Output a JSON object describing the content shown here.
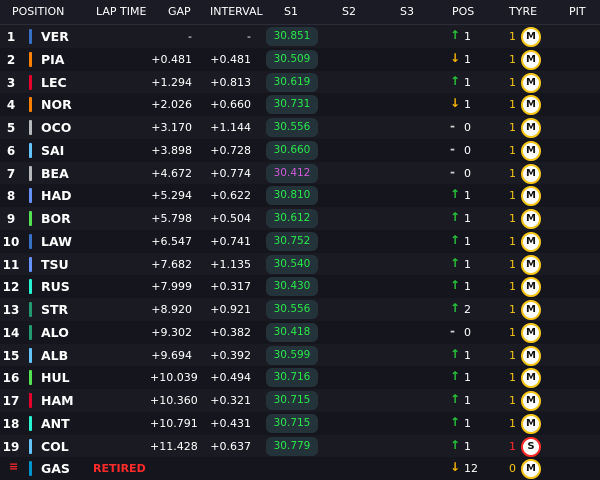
{
  "colors": {
    "up": "#29c33b",
    "down": "#f4b400",
    "best": "#29e84a",
    "purple": "#d15ad9",
    "medium": "#f5c518",
    "soft": "#ff2b2b"
  },
  "headers": {
    "position": "POSITION",
    "lap_time": "LAP TIME",
    "gap": "GAP",
    "interval": "INTERVAL",
    "s1": "S1",
    "s2": "S2",
    "s3": "S3",
    "pos": "POS",
    "tyre": "TYRE",
    "pit": "PIT"
  },
  "rows": [
    {
      "pos": "1",
      "code": "VER",
      "team": "#3671c6",
      "gap": "-",
      "interval": "-",
      "s1": "30.851",
      "s1_color": "best",
      "dir": "up",
      "delta": "1",
      "tyre_laps": "1",
      "tyre": "M"
    },
    {
      "pos": "2",
      "code": "PIA",
      "team": "#ff8000",
      "gap": "+0.481",
      "interval": "+0.481",
      "s1": "30.509",
      "s1_color": "best",
      "dir": "down",
      "delta": "1",
      "tyre_laps": "1",
      "tyre": "M"
    },
    {
      "pos": "3",
      "code": "LEC",
      "team": "#e8002d",
      "gap": "+1.294",
      "interval": "+0.813",
      "s1": "30.619",
      "s1_color": "best",
      "dir": "up",
      "delta": "1",
      "tyre_laps": "1",
      "tyre": "M"
    },
    {
      "pos": "4",
      "code": "NOR",
      "team": "#ff8000",
      "gap": "+2.026",
      "interval": "+0.660",
      "s1": "30.731",
      "s1_color": "best",
      "dir": "down",
      "delta": "1",
      "tyre_laps": "1",
      "tyre": "M"
    },
    {
      "pos": "5",
      "code": "OCO",
      "team": "#b6babd",
      "gap": "+3.170",
      "interval": "+1.144",
      "s1": "30.556",
      "s1_color": "best",
      "dir": "none",
      "delta": "0",
      "tyre_laps": "1",
      "tyre": "M"
    },
    {
      "pos": "6",
      "code": "SAI",
      "team": "#64c4ff",
      "gap": "+3.898",
      "interval": "+0.728",
      "s1": "30.660",
      "s1_color": "best",
      "dir": "none",
      "delta": "0",
      "tyre_laps": "1",
      "tyre": "M"
    },
    {
      "pos": "7",
      "code": "BEA",
      "team": "#b6babd",
      "gap": "+4.672",
      "interval": "+0.774",
      "s1": "30.412",
      "s1_color": "purple",
      "dir": "none",
      "delta": "0",
      "tyre_laps": "1",
      "tyre": "M"
    },
    {
      "pos": "8",
      "code": "HAD",
      "team": "#6692ff",
      "gap": "+5.294",
      "interval": "+0.622",
      "s1": "30.810",
      "s1_color": "best",
      "dir": "up",
      "delta": "1",
      "tyre_laps": "1",
      "tyre": "M"
    },
    {
      "pos": "9",
      "code": "BOR",
      "team": "#52e252",
      "gap": "+5.798",
      "interval": "+0.504",
      "s1": "30.612",
      "s1_color": "best",
      "dir": "up",
      "delta": "1",
      "tyre_laps": "1",
      "tyre": "M"
    },
    {
      "pos": "10",
      "code": "LAW",
      "team": "#3671c6",
      "gap": "+6.547",
      "interval": "+0.741",
      "s1": "30.752",
      "s1_color": "best",
      "dir": "up",
      "delta": "1",
      "tyre_laps": "1",
      "tyre": "M"
    },
    {
      "pos": "11",
      "code": "TSU",
      "team": "#6692ff",
      "gap": "+7.682",
      "interval": "+1.135",
      "s1": "30.540",
      "s1_color": "best",
      "dir": "up",
      "delta": "1",
      "tyre_laps": "1",
      "tyre": "M"
    },
    {
      "pos": "12",
      "code": "RUS",
      "team": "#27f4d2",
      "gap": "+7.999",
      "interval": "+0.317",
      "s1": "30.430",
      "s1_color": "best",
      "dir": "up",
      "delta": "1",
      "tyre_laps": "1",
      "tyre": "M"
    },
    {
      "pos": "13",
      "code": "STR",
      "team": "#229971",
      "gap": "+8.920",
      "interval": "+0.921",
      "s1": "30.556",
      "s1_color": "best",
      "dir": "up",
      "delta": "2",
      "tyre_laps": "1",
      "tyre": "M"
    },
    {
      "pos": "14",
      "code": "ALO",
      "team": "#229971",
      "gap": "+9.302",
      "interval": "+0.382",
      "s1": "30.418",
      "s1_color": "best",
      "dir": "none",
      "delta": "0",
      "tyre_laps": "1",
      "tyre": "M"
    },
    {
      "pos": "15",
      "code": "ALB",
      "team": "#64c4ff",
      "gap": "+9.694",
      "interval": "+0.392",
      "s1": "30.599",
      "s1_color": "best",
      "dir": "up",
      "delta": "1",
      "tyre_laps": "1",
      "tyre": "M"
    },
    {
      "pos": "16",
      "code": "HUL",
      "team": "#52e252",
      "gap": "+10.039",
      "interval": "+0.494",
      "s1": "30.716",
      "s1_color": "best",
      "dir": "up",
      "delta": "1",
      "tyre_laps": "1",
      "tyre": "M"
    },
    {
      "pos": "17",
      "code": "HAM",
      "team": "#e8002d",
      "gap": "+10.360",
      "interval": "+0.321",
      "s1": "30.715",
      "s1_color": "best",
      "dir": "up",
      "delta": "1",
      "tyre_laps": "1",
      "tyre": "M"
    },
    {
      "pos": "18",
      "code": "ANT",
      "team": "#27f4d2",
      "gap": "+10.791",
      "interval": "+0.431",
      "s1": "30.715",
      "s1_color": "best",
      "dir": "up",
      "delta": "1",
      "tyre_laps": "1",
      "tyre": "M"
    },
    {
      "pos": "19",
      "code": "COL",
      "team": "#64c4ff",
      "gap": "+11.428",
      "interval": "+0.637",
      "s1": "30.779",
      "s1_color": "best",
      "dir": "up",
      "delta": "1",
      "tyre_laps": "1",
      "tyre": "S"
    },
    {
      "pos": "",
      "code": "GAS",
      "team": "#0093cc",
      "status": "RETIRED",
      "gap": "",
      "interval": "",
      "s1": "",
      "s1_color": "best",
      "dir": "down",
      "delta": "12",
      "tyre_laps": "0",
      "tyre": "M"
    }
  ]
}
